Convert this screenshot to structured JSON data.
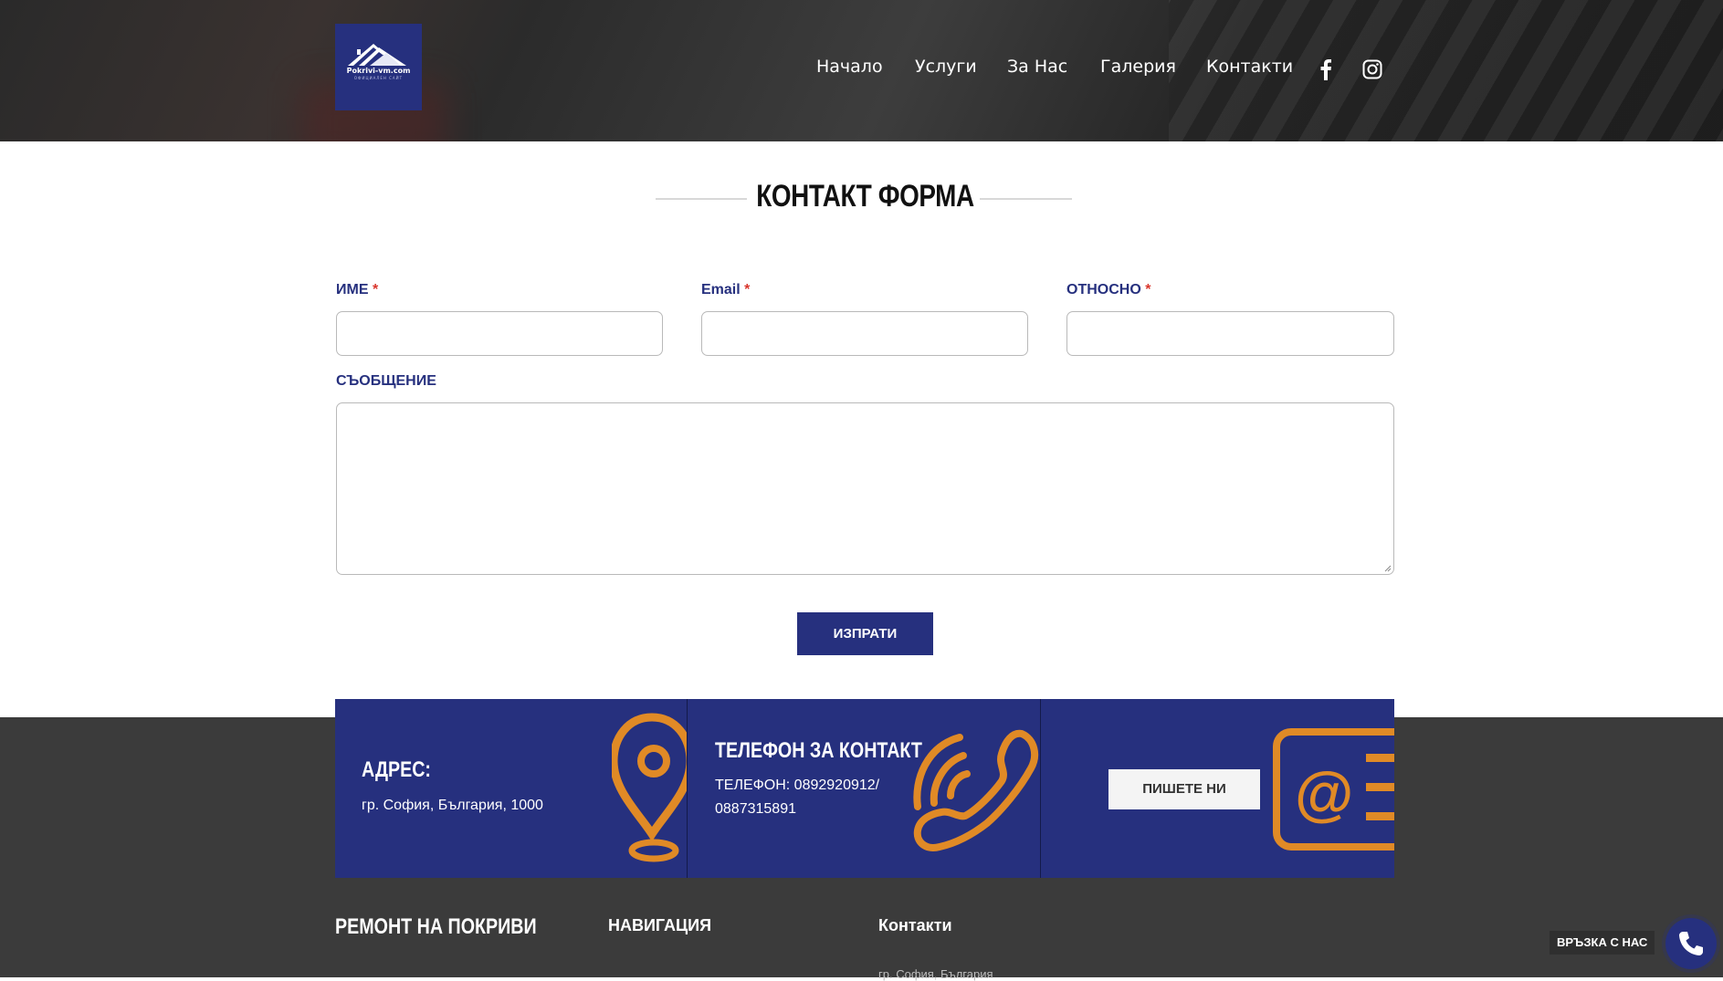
{
  "header": {
    "logo_text": "Pokrivi-vm.com",
    "logo_subtext": "ОФИЦИАЛЕН САЙТ",
    "nav": [
      "Начало",
      "Услуги",
      "За Нас",
      "Галерия",
      "Контакти"
    ],
    "social_icons": [
      "facebook-icon",
      "instagram-icon"
    ]
  },
  "contact_form": {
    "title": "КОНТАКТ ФОРМА",
    "name_label": "ИМЕ",
    "email_label": "Email",
    "subject_label": "ОТНОСНО",
    "required_mark": "*",
    "message_label": "СЪОБЩЕНИЕ",
    "submit_label": "ИЗПРАТИ"
  },
  "info_panels": {
    "address_title": "АДРЕС:",
    "address_text": "гр. София, България, 1000",
    "phone_title": "ТЕЛЕФОН ЗА КОНТАКТ",
    "phone_line1": "ТЕЛЕФОН: 0892920912/",
    "phone_line2": "0887315891",
    "write_button": "ПИШЕТЕ НИ"
  },
  "footer": {
    "col1_title": "РЕМОНТ НА ПОКРИВИ",
    "col2_title": "НАВИГАЦИЯ",
    "col3_title": "Контакти",
    "col3_text": "гр. София, България"
  },
  "floating": {
    "call_badge": "ВРЪЗКА С НАС"
  },
  "colors": {
    "brand_blue": "#26307e",
    "accent_orange": "#e08a26",
    "required_red": "#d9352b",
    "footer_bg": "#3b3b3b"
  }
}
